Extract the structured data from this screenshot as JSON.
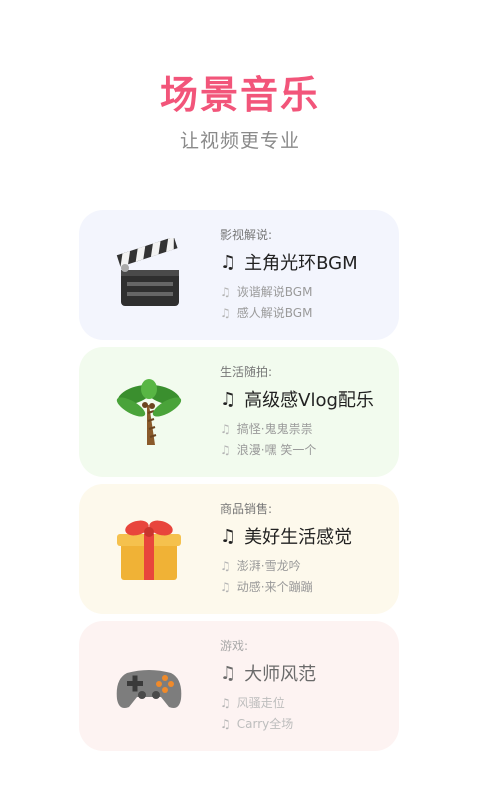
{
  "header": {
    "title": "场景音乐",
    "subtitle": "让视频更专业"
  },
  "note_glyph": "♫",
  "cards": [
    {
      "category": "影视解说:",
      "main": "主角光环BGM",
      "subs": [
        "诙谐解说BGM",
        "感人解说BGM"
      ],
      "bg": "#f3f5fd",
      "icon": "clapperboard-icon"
    },
    {
      "category": "生活随拍:",
      "main": "高级感Vlog配乐",
      "subs": [
        "搞怪·鬼鬼祟祟",
        "浪漫·嘿 笑一个"
      ],
      "bg": "#f2fbee",
      "icon": "palm-tree-icon"
    },
    {
      "category": "商品销售:",
      "main": "美好生活感觉",
      "subs": [
        "澎湃·雪龙吟",
        "动感·来个蹦蹦"
      ],
      "bg": "#fdf9ec",
      "icon": "gift-icon"
    },
    {
      "category": "游戏:",
      "main": "大师风范",
      "subs": [
        "风骚走位",
        "Carry全场"
      ],
      "bg": "#fdf3f2",
      "icon": "gamepad-icon"
    }
  ]
}
